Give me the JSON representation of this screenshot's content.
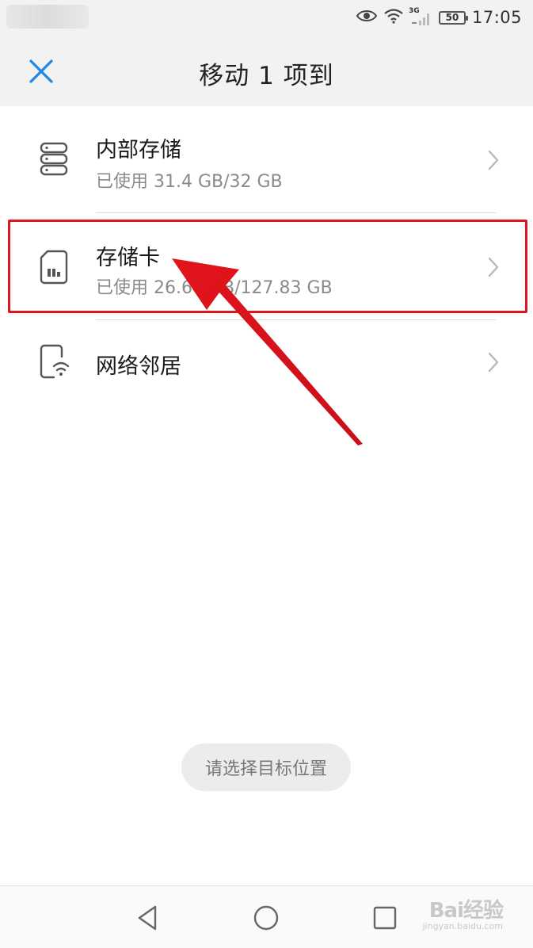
{
  "status_bar": {
    "time": "17:05",
    "battery": "50",
    "network": "3G",
    "icons": [
      "eye-icon",
      "wifi-icon",
      "signal-icon",
      "battery-icon"
    ]
  },
  "header": {
    "title": "移动 1 项到",
    "close_icon": "close-icon",
    "accent_color": "#1e88e5"
  },
  "storage_list": [
    {
      "icon": "storage-server-icon",
      "title": "内部存储",
      "subtitle": "已使用 31.4 GB/32 GB"
    },
    {
      "icon": "sd-card-icon",
      "title": "存储卡",
      "subtitle": "已使用 26.66 GB/127.83 GB"
    },
    {
      "icon": "network-neighbor-icon",
      "title": "网络邻居",
      "subtitle": ""
    }
  ],
  "toast": {
    "text": "请选择目标位置"
  },
  "annotation": {
    "highlight_color": "#e0161e"
  },
  "nav_bar": {
    "icons": [
      "back-icon",
      "home-icon",
      "recents-icon"
    ]
  },
  "watermark": {
    "logo": "Bai经验",
    "url": "jingyan.baidu.com"
  }
}
